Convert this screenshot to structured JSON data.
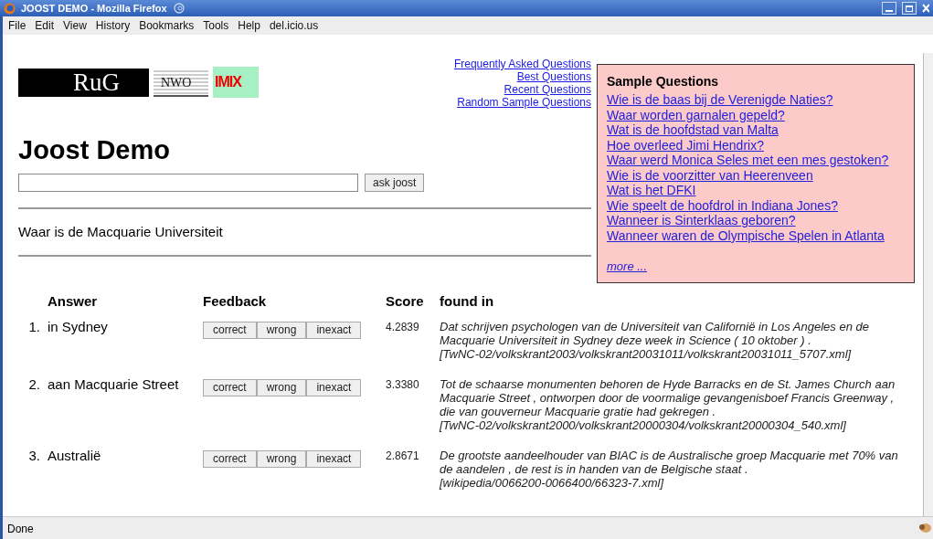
{
  "window": {
    "title": "JOOST DEMO - Mozilla Firefox"
  },
  "menu": [
    "File",
    "Edit",
    "View",
    "History",
    "Bookmarks",
    "Tools",
    "Help",
    "del.icio.us"
  ],
  "logos": [
    {
      "kind": "rug",
      "text": "RuG"
    },
    {
      "kind": "nwo",
      "text": "NWO"
    },
    {
      "kind": "imix",
      "text": "IMIX"
    }
  ],
  "nav_links": [
    "Frequently Asked Questions",
    "Best Questions",
    "Recent Questions",
    "Random Sample Questions"
  ],
  "heading": "Joost Demo",
  "search": {
    "button": "ask joost"
  },
  "question": "Waar is de Macquarie Universiteit",
  "sample_questions": {
    "title": "Sample Questions",
    "questions": [
      "Wie is de baas bij de Verenigde Naties?",
      "Waar worden garnalen gepeld?",
      "Wat is de hoofdstad van Malta",
      "Hoe overleed Jimi Hendrix?",
      "Waar werd Monica Seles met een mes gestoken?",
      "Wie is de voorzitter van Heerenveen",
      "Wat is het DFKI",
      "Wie speelt de hoofdrol in Indiana Jones?",
      "Wanneer is Sinterklaas geboren?",
      "Wanneer waren de Olympische Spelen in Atlanta"
    ],
    "more": "more ..."
  },
  "results": {
    "columns": [
      "Answer",
      "Feedback",
      "Score",
      "found in"
    ],
    "rows": [
      {
        "rank": "1.",
        "answer": "in Sydney",
        "feedback": [
          "correct",
          "wrong",
          "inexact"
        ],
        "score": "4.2839",
        "snippet": "Dat schrijven psychologen van de Universiteit van Californië in Los Angeles en de Macquarie Universiteit in Sydney deze week in Science ( 10 oktober ) .",
        "source": "[TwNC-02/volkskrant2003/volkskrant20031011/volkskrant20031011_5707.xml]"
      },
      {
        "rank": "2.",
        "answer": "aan Macquarie Street",
        "feedback": [
          "correct",
          "wrong",
          "inexact"
        ],
        "score": "3.3380",
        "snippet": "Tot de schaarse monumenten behoren de Hyde Barracks en de St. James Church aan Macquarie Street , ontworpen door de voormalige gevangenisboef Francis Greenway , die van gouverneur Macquarie gratie had gekregen .",
        "source": "[TwNC-02/volkskrant2000/volkskrant20000304/volkskrant20000304_540.xml]"
      },
      {
        "rank": "3.",
        "answer": "Australië",
        "feedback": [
          "correct",
          "wrong",
          "inexact"
        ],
        "score": "2.8671",
        "snippet": "De grootste aandeelhouder van BIAC is de Australische groep Macquarie met 70% van de aandelen , de rest is in handen van de Belgische staat .",
        "source": "[wikipedia/0066200-0066400/66323-7.xml]"
      }
    ]
  },
  "status_bar": "Done"
}
